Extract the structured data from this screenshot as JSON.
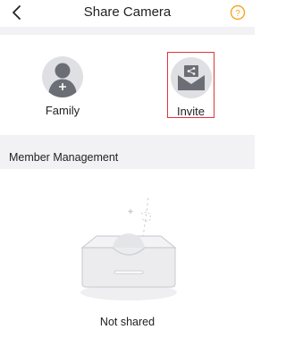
{
  "header": {
    "title": "Share Camera",
    "back_icon": "chevron-left-icon",
    "help_icon": "question-circle-icon",
    "help_glyph": "?"
  },
  "share_options": [
    {
      "label": "Family",
      "icon": "add-member-icon"
    },
    {
      "label": "Invite",
      "icon": "share-envelope-icon"
    }
  ],
  "member_section": {
    "title": "Member Management"
  },
  "empty_state": {
    "text": "Not shared",
    "icon": "empty-box-icon"
  },
  "colors": {
    "accent": "#f5a623",
    "highlight_border": "#e0343d",
    "icon_dark": "#6b6e75",
    "icon_bg": "#dfe0e4",
    "band": "#f2f2f4"
  }
}
